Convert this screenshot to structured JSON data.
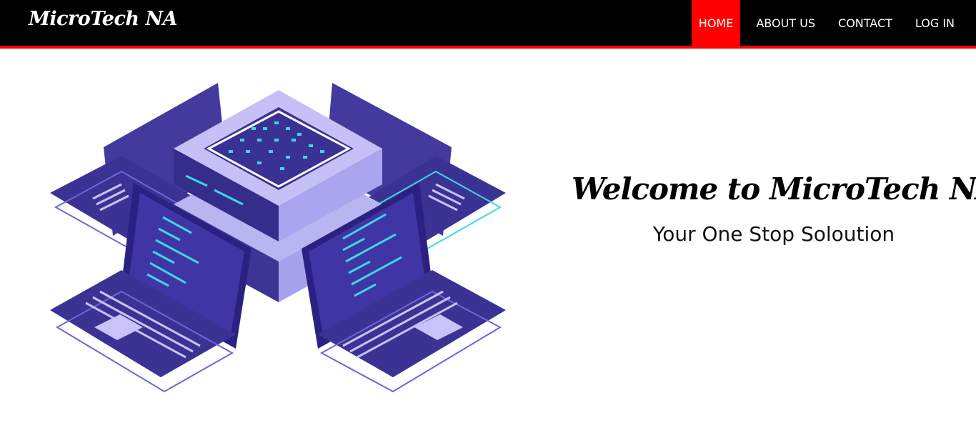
{
  "header": {
    "brand": "MicroTech NA",
    "nav": [
      {
        "label": "HOME",
        "active": true
      },
      {
        "label": "ABOUT US",
        "active": false
      },
      {
        "label": "CONTACT",
        "active": false
      },
      {
        "label": "LOG IN",
        "active": false
      }
    ]
  },
  "hero": {
    "title": "Welcome to MicroTech NA.",
    "subtitle": "Your One Stop Soloution",
    "illustration_icon": "server-with-laptops-icon"
  },
  "colors": {
    "navbar_bg": "#000000",
    "accent": "#ff0000",
    "illustration_primary": "#3d3596",
    "illustration_light": "#b9b5f1",
    "code_cyan": "#3fd6e6"
  }
}
